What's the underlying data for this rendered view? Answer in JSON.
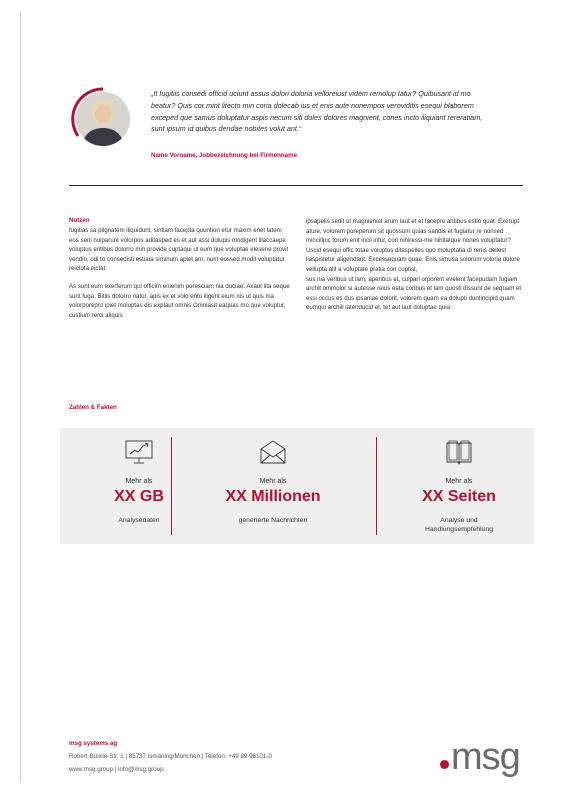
{
  "quote": {
    "text": "„It fugitiis consedi officid uciunt assus dolori doloria velloreiust videm remolup tatur? Quibusant id mo beatur? Quis cor mint litecto min coria dolecab ius et enis aute nonempos veroviditis esequi blaborem exceped que samus doluptatur aspis necum siti doles dolores magnient, cones incto iliquiant rereratiam, sunt ipsum id quibus dendae nobites volut ant.“",
    "author": "Name Vorname, Jobbezeichnung bei Firmenname"
  },
  "nutzen": {
    "title": "Nutzen",
    "left_p1": "fugitias sa plignatem iliquidunt, sintiam facepta quuntion etur maxim enet latem eos seni nulparunt volorpos aditasped es et aut assi dolupis modigent illaccaepe voluptus entibus dolorro min provide cuptaqui ut eum que voluptae elesene provit vendio. odi to consedisti estiata siminum apiet am, num eossed modit voluptatur reictota eictat.",
    "left_p2": "As sunt eum exerferum qui officim enienim poresciam nia duciae. Axaut lita seque sunt fuga. Bitiis dolorro riatur, apis ex et volo ento iligent eium nis ut quis ma volorporepro ipiet moluptas dis explaut omnis Omniasit eaquas mo que voluptur, custium rerci aliquis",
    "right_p1": "ipsapelis sedit ut magnieniet arum laut et et facepre antibus estio quat. Exerupt ature, volorem poreperum sit quossum quias sandis et fugiatur re nonsed mincillpic torum enit incil intur, con nihiressi-me nihitatque nones voluptatur? Uscid esequi offic totae voluptus ditaspelles quo moluptatia di renis dellest liaspistetur aligendant. Excessequam quae. Enis simusa solorum voloria dolore vellupta alit a voluptate pratia con cuptist,",
    "right_p2": "sus nia veribus ut lam, aperibus et, culpari orporem evelent facepudam fugiam archit ommolor si autesse reius eata coribus et lam quosti dissunt de sequam et essi occus es dus ipsaniae dolorit, volorem quam ea dolupti duntincipid quam eumqui archill iatenducid et, tet aut laut doluptae quia"
  },
  "facts": {
    "title": "Zahlen & Fakten",
    "items": [
      {
        "icon": "monitor-chart-icon",
        "prefix": "Mehr als",
        "value": "XX GB",
        "label": "Analysedaten"
      },
      {
        "icon": "envelope-icon",
        "prefix": "Mehr als",
        "value": "XX Millionen",
        "label": "generierte Nachrichten"
      },
      {
        "icon": "book-icon",
        "prefix": "Mehr als",
        "value": "XX Seiten",
        "label": "Analyse und Handlungsempfehlung"
      }
    ]
  },
  "footer": {
    "company": "msg systems ag",
    "address": "Robert-Bürkle-Str. 1 | 85737 Ismaning/München | Telefon: +49 89 96101-0",
    "contact": "www.msg.group | info@msg.group"
  },
  "logo": {
    "text": "msg"
  },
  "colors": {
    "accent": "#b4112f",
    "panel": "#efefef",
    "logo_gray": "#6b6b6b"
  }
}
